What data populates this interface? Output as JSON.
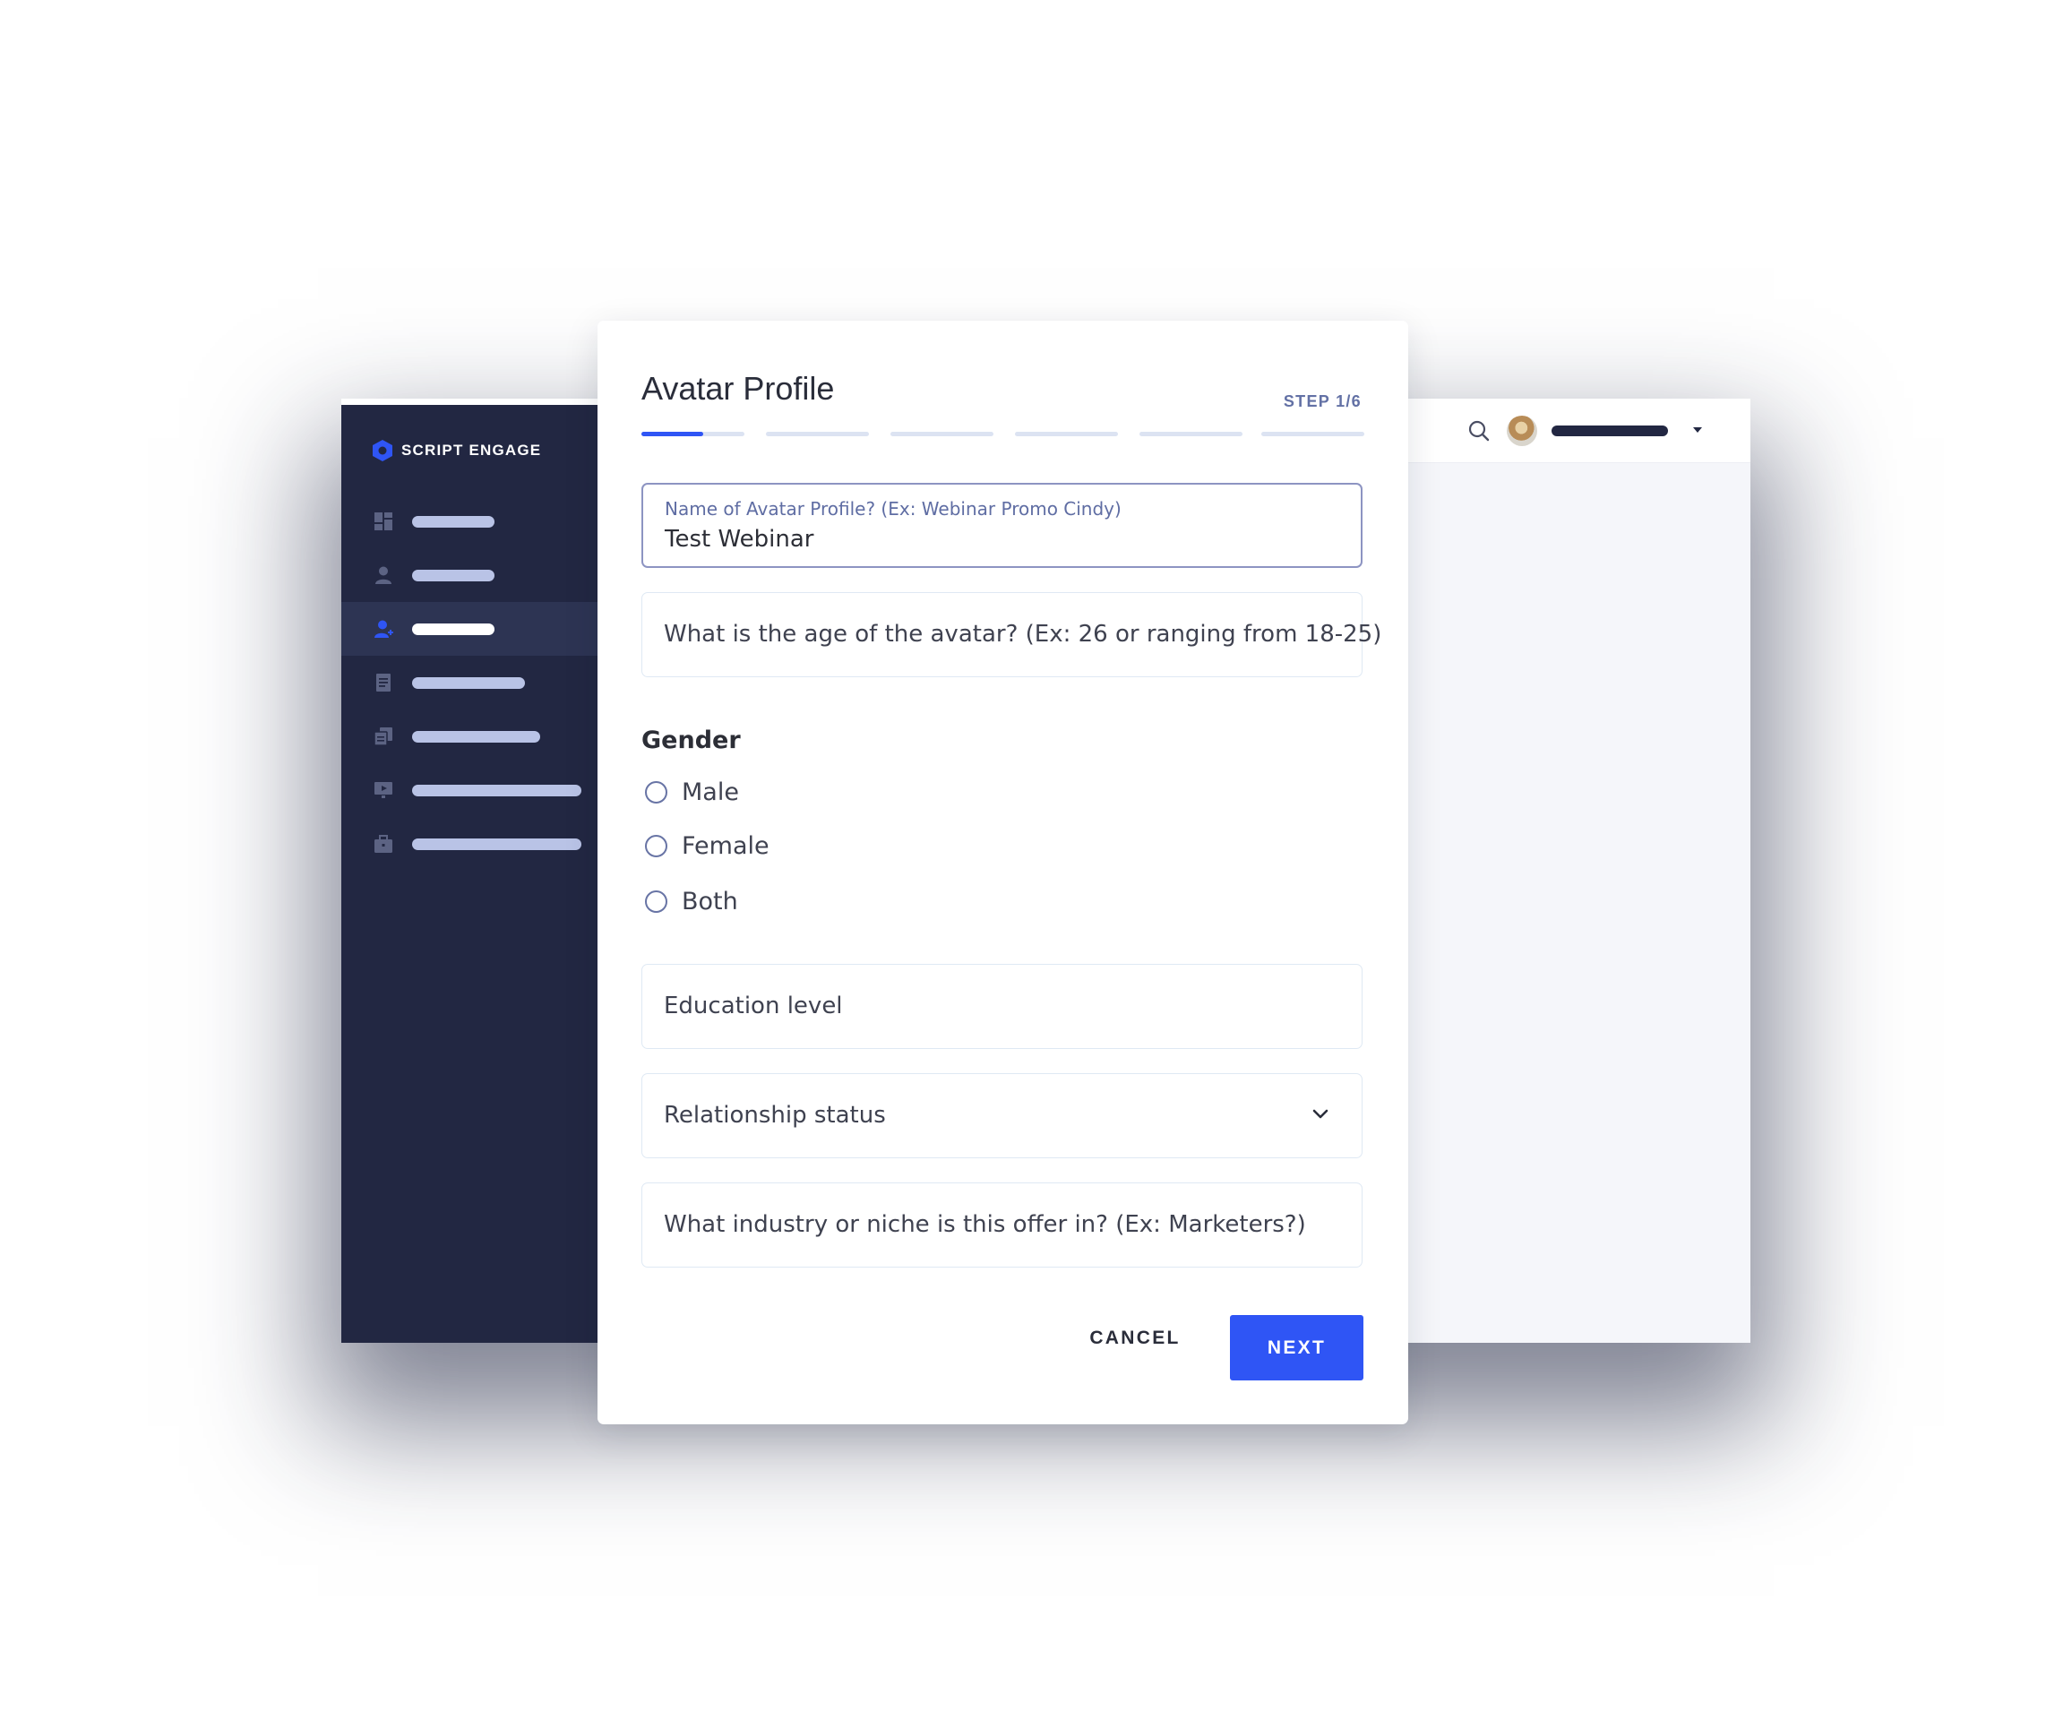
{
  "app": {
    "brand": "SCRIPT ENGAGE",
    "accent_color": "#2f55f5",
    "sidebar_color": "#222742",
    "nav_items": [
      {
        "icon": "dashboard-icon",
        "active": false
      },
      {
        "icon": "user-icon",
        "active": false
      },
      {
        "icon": "add-user-icon",
        "active": true
      },
      {
        "icon": "document-icon",
        "active": false
      },
      {
        "icon": "copy-icon",
        "active": false
      },
      {
        "icon": "presentation-icon",
        "active": false
      },
      {
        "icon": "briefcase-icon",
        "active": false
      }
    ],
    "topbar": {
      "icons": [
        "search-icon",
        "avatar",
        "caret-down-icon"
      ]
    }
  },
  "modal": {
    "title": "Avatar Profile",
    "step": "STEP 1/6",
    "progress": {
      "current_step": 1,
      "total_steps": 6,
      "current_segment_fill": 0.6
    },
    "fields": {
      "avatar_name": {
        "label": "Name of Avatar Profile? (Ex: Webinar Promo Cindy)",
        "value": "Test Webinar"
      },
      "age": {
        "placeholder": "What is the age of the avatar? (Ex: 26 or ranging from 18-25)"
      },
      "education": {
        "placeholder": "Education level"
      },
      "relationship": {
        "placeholder": "Relationship status",
        "icon": "chevron-down-icon"
      },
      "industry": {
        "placeholder": "What industry or niche is this offer in? (Ex: Marketers?)"
      }
    },
    "gender": {
      "heading": "Gender",
      "options": [
        "Male",
        "Female",
        "Both"
      ],
      "selected": null
    },
    "buttons": {
      "cancel": "CANCEL",
      "next": "NEXT"
    }
  }
}
